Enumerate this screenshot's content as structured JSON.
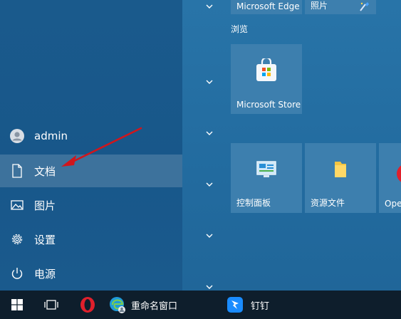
{
  "left_menu": {
    "user": "admin",
    "documents": "文档",
    "pictures": "图片",
    "settings": "设置",
    "power": "电源"
  },
  "tiles": {
    "group_label": "浏览",
    "edge": "Microsoft Edge",
    "photos": "照片",
    "store": "Microsoft Store",
    "control_panel": "控制面板",
    "explorer": "资源文件",
    "opera": "Ope"
  },
  "taskbar": {
    "rename_window": "重命名窗口",
    "dingtalk": "钉钉"
  },
  "colors": {
    "annotation_arrow": "#d0161c",
    "hover_highlight": "rgba(255,255,255,0.16)",
    "tile": "#3d7fae",
    "taskbar": "#0e1e2c"
  }
}
